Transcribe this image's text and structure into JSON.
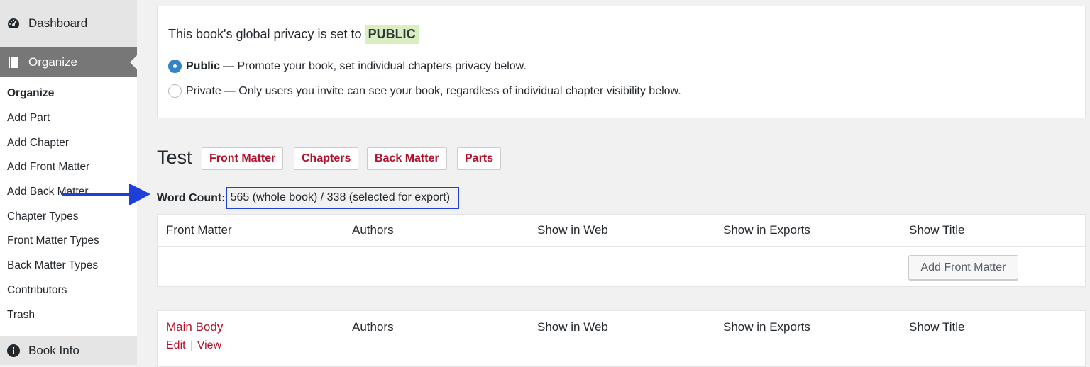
{
  "sidebar": {
    "dashboard": "Dashboard",
    "organize_top": "Organize",
    "items": [
      {
        "label": "Organize",
        "current": true
      },
      {
        "label": "Add Part"
      },
      {
        "label": "Add Chapter"
      },
      {
        "label": "Add Front Matter"
      },
      {
        "label": "Add Back Matter"
      },
      {
        "label": "Chapter Types"
      },
      {
        "label": "Front Matter Types"
      },
      {
        "label": "Back Matter Types"
      },
      {
        "label": "Contributors"
      },
      {
        "label": "Trash"
      }
    ],
    "book_info": "Book Info"
  },
  "privacy": {
    "title": "This book's global privacy is set to",
    "badge": "PUBLIC",
    "public_label": "Public",
    "public_desc": "— Promote your book, set individual chapters privacy below.",
    "private_label": "Private",
    "private_desc": "— Only users you invite can see your book, regardless of individual chapter visibility below."
  },
  "book": {
    "title": "Test",
    "buttons": [
      "Front Matter",
      "Chapters",
      "Back Matter",
      "Parts"
    ],
    "word_count_label": "Word Count:",
    "word_count_value": "565 (whole book) / 338 (selected for export)"
  },
  "front_matter_table": {
    "columns": [
      "Front Matter",
      "Authors",
      "Show in Web",
      "Show in Exports",
      "Show Title"
    ],
    "add_button": "Add Front Matter"
  },
  "main_body_table": {
    "columns": [
      "Main Body",
      "Authors",
      "Show in Web",
      "Show in Exports",
      "Show Title"
    ],
    "actions": [
      "Edit",
      "View"
    ],
    "separator": "|"
  },
  "colors": {
    "accent_red": "#b3102a",
    "highlight_blue": "#1e3fd8",
    "radio_blue": "#3582c4",
    "public_badge_bg": "#d9efc2"
  }
}
